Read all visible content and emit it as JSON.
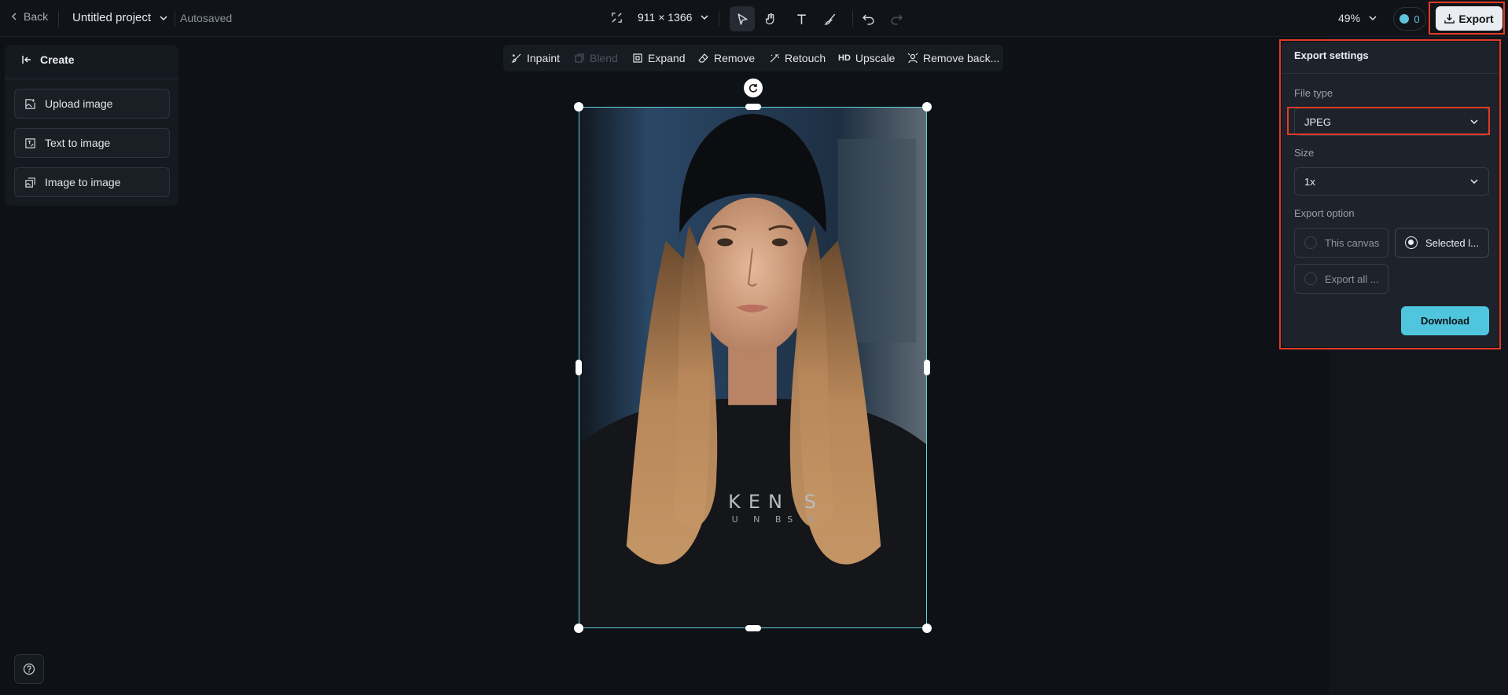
{
  "topbar": {
    "back_label": "Back",
    "project_name": "Untitled project",
    "save_status": "Autosaved",
    "dimensions": "911 × 1366",
    "zoom": "49%",
    "credits": "0",
    "export_label": "Export"
  },
  "left_panel": {
    "header": "Create",
    "buttons": [
      {
        "label": "Upload image",
        "icon": "upload-image-icon"
      },
      {
        "label": "Text to image",
        "icon": "text-to-image-icon"
      },
      {
        "label": "Image to image",
        "icon": "image-to-image-icon"
      }
    ]
  },
  "edit_toolbar": {
    "items": [
      {
        "label": "Inpaint",
        "enabled": true
      },
      {
        "label": "Blend",
        "enabled": false
      },
      {
        "label": "Expand",
        "enabled": true
      },
      {
        "label": "Remove",
        "enabled": true
      },
      {
        "label": "Retouch",
        "enabled": true
      },
      {
        "label": "Upscale",
        "badge": "HD",
        "enabled": true
      },
      {
        "label": "Remove back...",
        "enabled": true
      }
    ]
  },
  "export_panel": {
    "title": "Export settings",
    "file_type_label": "File type",
    "file_type_value": "JPEG",
    "size_label": "Size",
    "size_value": "1x",
    "export_option_label": "Export option",
    "options": [
      {
        "label": "This canvas",
        "selected": false
      },
      {
        "label": "Selected l...",
        "selected": true
      },
      {
        "label": "Export all ...",
        "selected": false
      }
    ],
    "download_label": "Download"
  },
  "canvas": {
    "shirt_text_line1": "KEN S",
    "shirt_text_line2": "U N BS R"
  },
  "colors": {
    "accent": "#4fc6de",
    "selection": "#5fd4d6",
    "highlight": "#e23a25",
    "background": "#0e1116"
  }
}
